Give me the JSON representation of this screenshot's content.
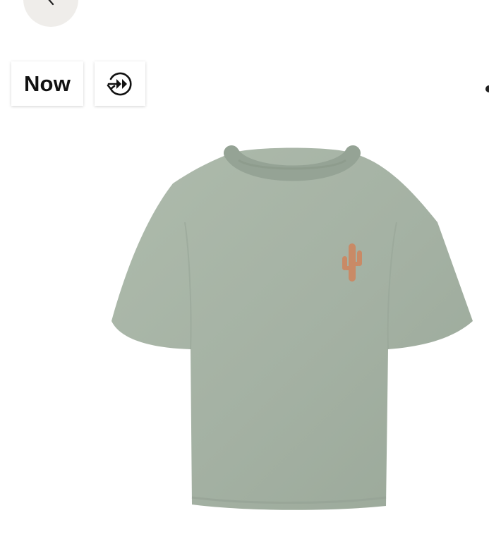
{
  "header": {
    "back_icon": "chevron-left-icon"
  },
  "badges": {
    "now_label": "Now",
    "fast_forward_icon": "fast-forward-circle-icon"
  },
  "product": {
    "image_icon": "t-shirt-image",
    "color": "#a7b4a6",
    "logo_color": "#c98a66"
  }
}
